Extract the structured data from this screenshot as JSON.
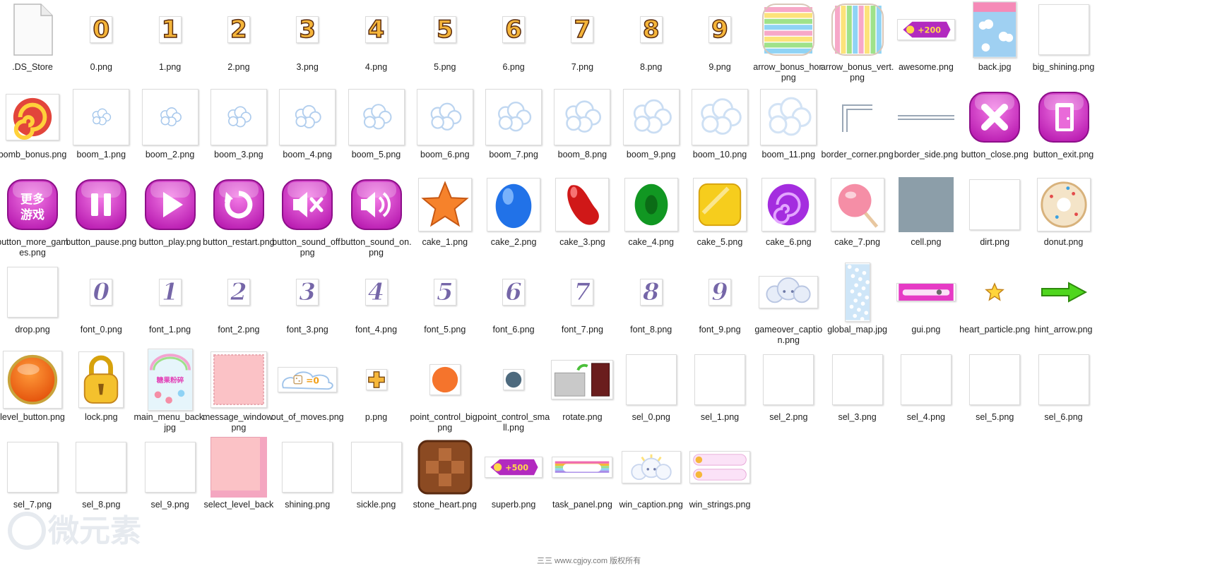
{
  "explorer": {
    "files": [
      {
        "name": ".DS_Store",
        "icon": "generic-file-icon"
      },
      {
        "name": "0.png",
        "icon": "digit-0-icon",
        "glyph": "0"
      },
      {
        "name": "1.png",
        "icon": "digit-1-icon",
        "glyph": "1"
      },
      {
        "name": "2.png",
        "icon": "digit-2-icon",
        "glyph": "2"
      },
      {
        "name": "3.png",
        "icon": "digit-3-icon",
        "glyph": "3"
      },
      {
        "name": "4.png",
        "icon": "digit-4-icon",
        "glyph": "4"
      },
      {
        "name": "5.png",
        "icon": "digit-5-icon",
        "glyph": "5"
      },
      {
        "name": "6.png",
        "icon": "digit-6-icon",
        "glyph": "6"
      },
      {
        "name": "7.png",
        "icon": "digit-7-icon",
        "glyph": "7"
      },
      {
        "name": "8.png",
        "icon": "digit-8-icon",
        "glyph": "8"
      },
      {
        "name": "9.png",
        "icon": "digit-9-icon",
        "glyph": "9"
      },
      {
        "name": "arrow_bonus_hor.png",
        "icon": "striped-candy-horizontal-icon"
      },
      {
        "name": "arrow_bonus_vert.png",
        "icon": "striped-candy-vertical-icon"
      },
      {
        "name": "awesome.png",
        "icon": "score-badge-200-icon",
        "glyph": "+200"
      },
      {
        "name": "back.jpg",
        "icon": "sky-background-icon"
      },
      {
        "name": "big_shining.png",
        "icon": "blank-white-icon"
      },
      {
        "name": "bomb_bonus.png",
        "icon": "bomb-candy-icon"
      },
      {
        "name": "boom_1.png",
        "icon": "cloud-burst-icon"
      },
      {
        "name": "boom_2.png",
        "icon": "cloud-burst-icon"
      },
      {
        "name": "boom_3.png",
        "icon": "cloud-burst-icon"
      },
      {
        "name": "boom_4.png",
        "icon": "cloud-burst-icon"
      },
      {
        "name": "boom_5.png",
        "icon": "cloud-burst-icon"
      },
      {
        "name": "boom_6.png",
        "icon": "cloud-burst-icon"
      },
      {
        "name": "boom_7.png",
        "icon": "cloud-burst-icon"
      },
      {
        "name": "boom_8.png",
        "icon": "cloud-burst-icon"
      },
      {
        "name": "boom_9.png",
        "icon": "cloud-burst-icon"
      },
      {
        "name": "boom_10.png",
        "icon": "cloud-burst-icon"
      },
      {
        "name": "boom_11.png",
        "icon": "cloud-burst-icon"
      },
      {
        "name": "border_corner.png",
        "icon": "border-corner-icon"
      },
      {
        "name": "border_side.png",
        "icon": "border-side-icon"
      },
      {
        "name": "button_close.png",
        "icon": "close-button-icon"
      },
      {
        "name": "button_exit.png",
        "icon": "exit-door-button-icon"
      },
      {
        "name": "button_more_games.png",
        "icon": "more-games-button-icon",
        "glyph": "更多游戏"
      },
      {
        "name": "button_pause.png",
        "icon": "pause-button-icon"
      },
      {
        "name": "button_play.png",
        "icon": "play-button-icon"
      },
      {
        "name": "button_restart.png",
        "icon": "restart-button-icon"
      },
      {
        "name": "button_sound_off.png",
        "icon": "sound-off-button-icon"
      },
      {
        "name": "button_sound_on.png",
        "icon": "sound-on-button-icon"
      },
      {
        "name": "cake_1.png",
        "icon": "orange-star-candy-icon"
      },
      {
        "name": "cake_2.png",
        "icon": "blue-candy-icon"
      },
      {
        "name": "cake_3.png",
        "icon": "red-bean-candy-icon"
      },
      {
        "name": "cake_4.png",
        "icon": "green-candy-icon"
      },
      {
        "name": "cake_5.png",
        "icon": "yellow-square-candy-icon"
      },
      {
        "name": "cake_6.png",
        "icon": "purple-swirl-candy-icon"
      },
      {
        "name": "cake_7.png",
        "icon": "pink-lollipop-candy-icon"
      },
      {
        "name": "cell.png",
        "icon": "grey-cell-icon"
      },
      {
        "name": "dirt.png",
        "icon": "blank-white-icon"
      },
      {
        "name": "donut.png",
        "icon": "donut-icon"
      },
      {
        "name": "drop.png",
        "icon": "blank-white-icon"
      },
      {
        "name": "font_0.png",
        "icon": "font-digit-icon",
        "glyph": "0"
      },
      {
        "name": "font_1.png",
        "icon": "font-digit-icon",
        "glyph": "1"
      },
      {
        "name": "font_2.png",
        "icon": "font-digit-icon",
        "glyph": "2"
      },
      {
        "name": "font_3.png",
        "icon": "font-digit-icon",
        "glyph": "3"
      },
      {
        "name": "font_4.png",
        "icon": "font-digit-icon",
        "glyph": "4"
      },
      {
        "name": "font_5.png",
        "icon": "font-digit-icon",
        "glyph": "5"
      },
      {
        "name": "font_6.png",
        "icon": "font-digit-icon",
        "glyph": "6"
      },
      {
        "name": "font_7.png",
        "icon": "font-digit-icon",
        "glyph": "7"
      },
      {
        "name": "font_8.png",
        "icon": "font-digit-icon",
        "glyph": "8"
      },
      {
        "name": "font_9.png",
        "icon": "font-digit-icon",
        "glyph": "9"
      },
      {
        "name": "gameover_caption.png",
        "icon": "sad-cloud-caption-icon"
      },
      {
        "name": "global_map.jpg",
        "icon": "global-map-icon"
      },
      {
        "name": "gui.png",
        "icon": "gui-bar-icon"
      },
      {
        "name": "heart_particle.png",
        "icon": "star-particle-icon"
      },
      {
        "name": "hint_arrow.png",
        "icon": "green-arrow-icon"
      },
      {
        "name": "level_button.png",
        "icon": "orange-orb-button-icon"
      },
      {
        "name": "lock.png",
        "icon": "padlock-icon"
      },
      {
        "name": "main_menu_back.jpg",
        "icon": "main-menu-background-icon",
        "glyph": "糖果粉碎"
      },
      {
        "name": "message_window.png",
        "icon": "pink-window-icon"
      },
      {
        "name": "out_of_moves.png",
        "icon": "out-of-moves-cloud-icon",
        "glyph": "=0"
      },
      {
        "name": "p.png",
        "icon": "plus-icon"
      },
      {
        "name": "point_control_big.png",
        "icon": "orange-dot-icon"
      },
      {
        "name": "point_control_small.png",
        "icon": "grey-blue-dot-icon"
      },
      {
        "name": "rotate.png",
        "icon": "rotate-image-icon"
      },
      {
        "name": "sel_0.png",
        "icon": "blank-white-icon"
      },
      {
        "name": "sel_1.png",
        "icon": "blank-white-icon"
      },
      {
        "name": "sel_2.png",
        "icon": "blank-white-icon"
      },
      {
        "name": "sel_3.png",
        "icon": "blank-white-icon"
      },
      {
        "name": "sel_4.png",
        "icon": "blank-white-icon"
      },
      {
        "name": "sel_5.png",
        "icon": "blank-white-icon"
      },
      {
        "name": "sel_6.png",
        "icon": "blank-white-icon"
      },
      {
        "name": "sel_7.png",
        "icon": "blank-white-icon"
      },
      {
        "name": "sel_8.png",
        "icon": "blank-white-icon"
      },
      {
        "name": "sel_9.png",
        "icon": "blank-white-icon"
      },
      {
        "name": "select_level_back",
        "icon": "pink-panel-icon"
      },
      {
        "name": "shining.png",
        "icon": "blank-white-icon"
      },
      {
        "name": "sickle.png",
        "icon": "blank-white-icon"
      },
      {
        "name": "stone_heart.png",
        "icon": "chocolate-block-icon"
      },
      {
        "name": "superb.png",
        "icon": "score-badge-500-icon",
        "glyph": "+500"
      },
      {
        "name": "task_panel.png",
        "icon": "rainbow-bar-icon"
      },
      {
        "name": "win_caption.png",
        "icon": "happy-cloud-caption-icon"
      },
      {
        "name": "win_strings.png",
        "icon": "win-strings-icon"
      }
    ],
    "watermark": "微元素",
    "footer_text": "三三 www.cgjoy.com 版权所有"
  }
}
